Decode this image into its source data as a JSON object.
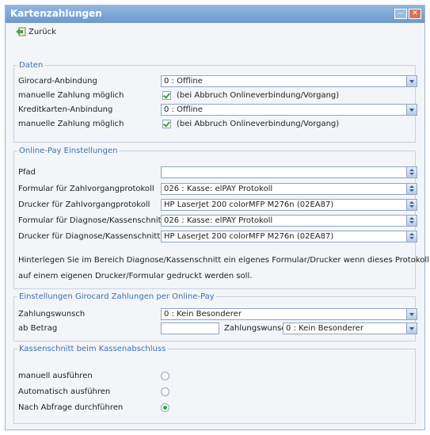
{
  "window": {
    "title": "Kartenzahlungen",
    "min_label": "—",
    "close_label": "✕"
  },
  "toolbar": {
    "back_label": "Zurück"
  },
  "daten": {
    "legend": "Daten",
    "girocard_label": "Girocard-Anbindung",
    "girocard_value": "0 : Offline",
    "manual1_label": "manuelle Zahlung möglich",
    "manual1_text": "(bei Abbruch Onlineverbindung/Vorgang)",
    "kreditkarten_label": "Kreditkarten-Anbindung",
    "kreditkarten_value": "0 : Offline",
    "manual2_label": "manuelle Zahlung möglich",
    "manual2_text": "(bei Abbruch Onlineverbindung/Vorgang)"
  },
  "onlinepay": {
    "legend": "Online-Pay Einstellungen",
    "pfad_label": "Pfad",
    "pfad_value": "",
    "formular_label": "Formular für Zahlvorgangprotokoll",
    "formular_value": "026 : Kasse: elPAY Protokoll",
    "drucker_label": "Drucker für Zahlvorgangprotokoll",
    "drucker_value": "HP LaserJet 200 colorMFP M276n (02EA87)",
    "formular_diag_label": "Formular für Diagnose/Kassenschnitt",
    "formular_diag_value": "026 : Kasse: elPAY Protokoll",
    "drucker_diag_label": "Drucker für Diagnose/Kassenschnitt",
    "drucker_diag_value": "HP LaserJet 200 colorMFP M276n (02EA87)",
    "hint_line1": "Hinterlegen Sie im Bereich Diagnose/Kassenschnitt ein eigenes Formular/Drucker wenn dieses Protokoll",
    "hint_line2": "auf einem eigenen Drucker/Formular gedruckt werden soll."
  },
  "girocard_online": {
    "legend": "Einstellungen Girocard Zahlungen per Online-Pay",
    "zahlungswunsch_label": "Zahlungswunsch",
    "zahlungswunsch_value": "0 : Kein Besonderer",
    "abbetrag_label": "ab Betrag",
    "abbetrag_value": "",
    "zahlungswunsch2_label": "Zahlungswunsch",
    "zahlungswunsch2_value": "0 : Kein Besonderer"
  },
  "kassenschnitt": {
    "legend": "Kassenschnitt beim Kassenabschluss",
    "options": [
      {
        "label": "manuell ausführen",
        "selected": false
      },
      {
        "label": "Automatisch ausführen",
        "selected": false
      },
      {
        "label": "Nach Abfrage durchführen",
        "selected": true
      }
    ]
  }
}
